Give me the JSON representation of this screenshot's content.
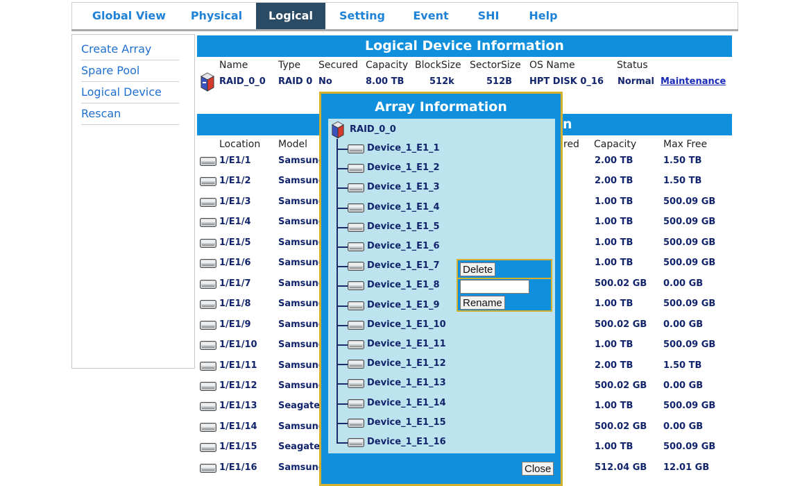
{
  "nav": {
    "tabs": [
      {
        "label": "Global View"
      },
      {
        "label": "Physical"
      },
      {
        "label": "Logical"
      },
      {
        "label": "Setting"
      },
      {
        "label": "Event"
      },
      {
        "label": "SHI"
      },
      {
        "label": "Help"
      }
    ],
    "active_tab": "Logical"
  },
  "sidebar": {
    "items": [
      {
        "label": "Create Array"
      },
      {
        "label": "Spare Pool"
      },
      {
        "label": "Logical Device"
      },
      {
        "label": "Rescan"
      }
    ]
  },
  "logical": {
    "title": "Logical Device Information",
    "headers": [
      "Name",
      "Type",
      "Secured",
      "Capacity",
      "BlockSize",
      "SectorSize",
      "OS Name",
      "Status"
    ],
    "row": {
      "name": "RAID_0_0",
      "type": "RAID 0",
      "secured": "No",
      "capacity": "8.00 TB",
      "blocksize": "512k",
      "sectorsize": "512B",
      "os_name": "HPT DISK 0_16",
      "status": "Normal",
      "action": "Maintenance"
    }
  },
  "physical": {
    "title_fragment": "n",
    "headers": {
      "location": "Location",
      "model": "Model",
      "secured_fragment": "red",
      "capacity": "Capacity",
      "max_free": "Max Free"
    },
    "rows": [
      {
        "location": "1/E1/1",
        "model": "Samsung",
        "capacity": "2.00 TB",
        "max_free": "1.50 TB"
      },
      {
        "location": "1/E1/2",
        "model": "Samsung",
        "capacity": "2.00 TB",
        "max_free": "1.50 TB"
      },
      {
        "location": "1/E1/3",
        "model": "Samsung",
        "capacity": "1.00 TB",
        "max_free": "500.09 GB"
      },
      {
        "location": "1/E1/4",
        "model": "Samsung",
        "capacity": "1.00 TB",
        "max_free": "500.09 GB"
      },
      {
        "location": "1/E1/5",
        "model": "Samsung",
        "capacity": "1.00 TB",
        "max_free": "500.09 GB"
      },
      {
        "location": "1/E1/6",
        "model": "Samsung",
        "capacity": "1.00 TB",
        "max_free": "500.09 GB"
      },
      {
        "location": "1/E1/7",
        "model": "Samsung",
        "capacity": "500.02 GB",
        "max_free": "0.00 GB"
      },
      {
        "location": "1/E1/8",
        "model": "Samsung",
        "capacity": "1.00 TB",
        "max_free": "500.09 GB"
      },
      {
        "location": "1/E1/9",
        "model": "Samsung",
        "capacity": "500.02 GB",
        "max_free": "0.00 GB"
      },
      {
        "location": "1/E1/10",
        "model": "Samsung",
        "capacity": "1.00 TB",
        "max_free": "500.09 GB"
      },
      {
        "location": "1/E1/11",
        "model": "Samsung",
        "capacity": "2.00 TB",
        "max_free": "1.50 TB"
      },
      {
        "location": "1/E1/12",
        "model": "Samsung",
        "capacity": "500.02 GB",
        "max_free": "0.00 GB"
      },
      {
        "location": "1/E1/13",
        "model": "Seagate",
        "capacity": "1.00 TB",
        "max_free": "500.09 GB"
      },
      {
        "location": "1/E1/14",
        "model": "Samsung",
        "capacity": "500.02 GB",
        "max_free": "0.00 GB"
      },
      {
        "location": "1/E1/15",
        "model": "Seagate",
        "capacity": "1.00 TB",
        "max_free": "500.09 GB"
      },
      {
        "location": "1/E1/16",
        "model": "Samsung",
        "capacity": "512.04 GB",
        "max_free": "12.01 GB"
      }
    ]
  },
  "modal": {
    "title": "Array Information",
    "root": "RAID_0_0",
    "devices": [
      "Device_1_E1_1",
      "Device_1_E1_2",
      "Device_1_E1_3",
      "Device_1_E1_4",
      "Device_1_E1_5",
      "Device_1_E1_6",
      "Device_1_E1_7",
      "Device_1_E1_8",
      "Device_1_E1_9",
      "Device_1_E1_10",
      "Device_1_E1_11",
      "Device_1_E1_12",
      "Device_1_E1_13",
      "Device_1_E1_14",
      "Device_1_E1_15",
      "Device_1_E1_16"
    ],
    "close_label": "Close"
  },
  "context_menu": {
    "delete_label": "Delete",
    "rename_value": "",
    "rename_label": "Rename"
  },
  "icons": {
    "disk": "disk-icon",
    "raid": "raid-array-icon"
  },
  "colors": {
    "accent_blue": "#0f8fdc",
    "nav_active": "#2b4a63",
    "modal_border": "#d6b02a",
    "modal_inner": "#bde3ee",
    "value_text": "#12246b"
  }
}
